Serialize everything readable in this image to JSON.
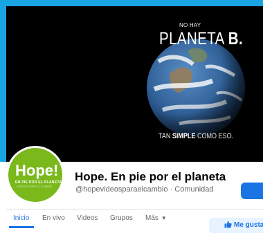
{
  "cover": {
    "small_text": "NO HAY",
    "big_text": "PLANETA",
    "big_text_strong": "B.",
    "bottom_text_pre": "TAN",
    "bottom_text_strong": "SIMPLE",
    "bottom_text_post": "COMO ESO."
  },
  "avatar": {
    "logo_text": "Hope!",
    "tagline": "EN PIE POR EL PLANETA",
    "subtagline": "VIDEOS PARA EL CAMBIO"
  },
  "page": {
    "name": "Hope. En pie por el planeta",
    "handle": "@hopevideosparaelcambio · Comunidad"
  },
  "tabs": [
    {
      "label": "Inicio",
      "active": true
    },
    {
      "label": "En vivo"
    },
    {
      "label": "Videos"
    },
    {
      "label": "Grupos"
    },
    {
      "label": "Más"
    }
  ],
  "like_button": {
    "label": "Me gusta"
  },
  "colors": {
    "accent": "#1b74e4",
    "brand_green": "#7ab81c",
    "frame_blue": "#19a5e3"
  }
}
